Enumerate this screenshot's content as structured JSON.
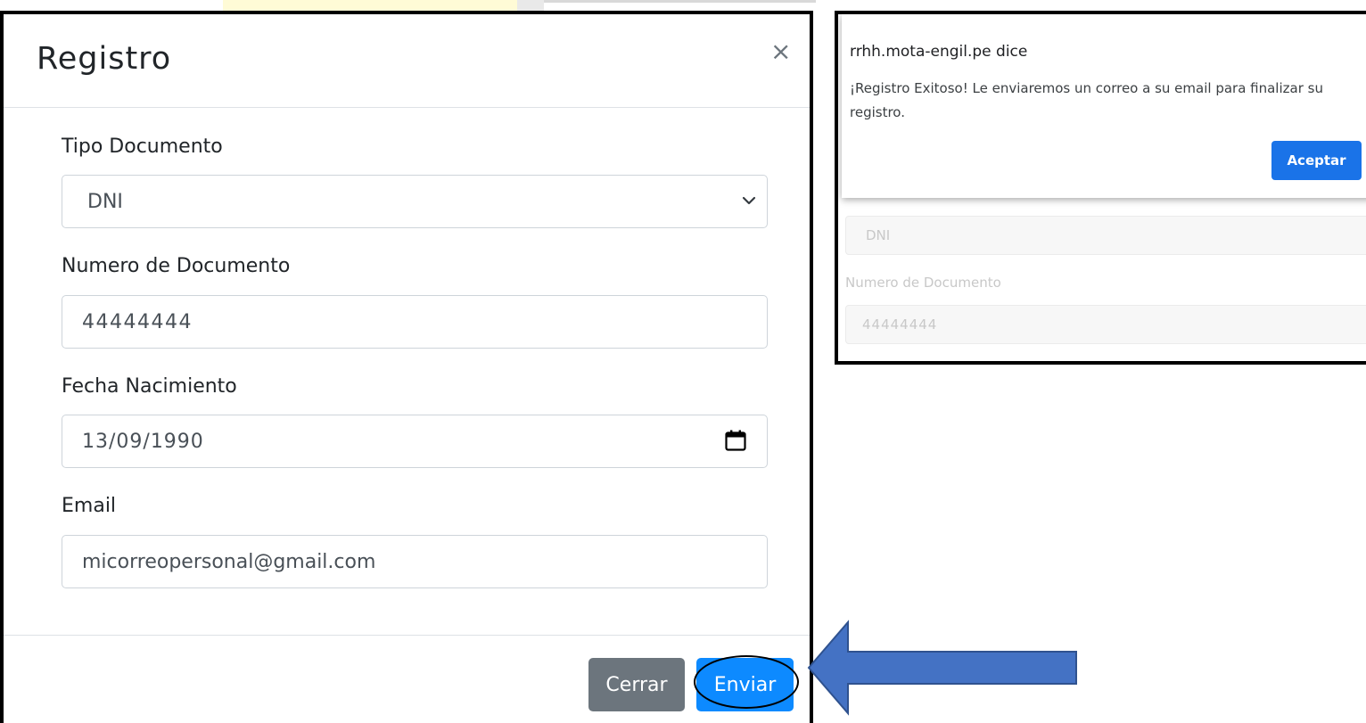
{
  "modal": {
    "title": "Registro",
    "close_label": "×",
    "tipo_documento": {
      "label": "Tipo Documento",
      "value": "DNI"
    },
    "numero_documento": {
      "label": "Numero de Documento",
      "value": "44444444"
    },
    "fecha_nacimiento": {
      "label": "Fecha Nacimiento",
      "value": "13/09/1990"
    },
    "email": {
      "label": "Email",
      "value": "micorreopersonal@gmail.com"
    },
    "buttons": {
      "cerrar": "Cerrar",
      "enviar": "Enviar"
    }
  },
  "alert": {
    "title": "rrhh.mota-engil.pe dice",
    "message": "¡Registro Exitoso! Le enviaremos un correo a su email para finalizar su registro.",
    "accept": "Aceptar"
  },
  "background_form": {
    "tipo_value": "DNI",
    "numero_label": "Numero de Documento",
    "numero_value": "44444444"
  },
  "colors": {
    "primary": "#0d8aff",
    "secondary": "#6c757d",
    "chrome_blue": "#1a73e8",
    "arrow_fill": "#4472c4",
    "arrow_stroke": "#2f528f"
  }
}
